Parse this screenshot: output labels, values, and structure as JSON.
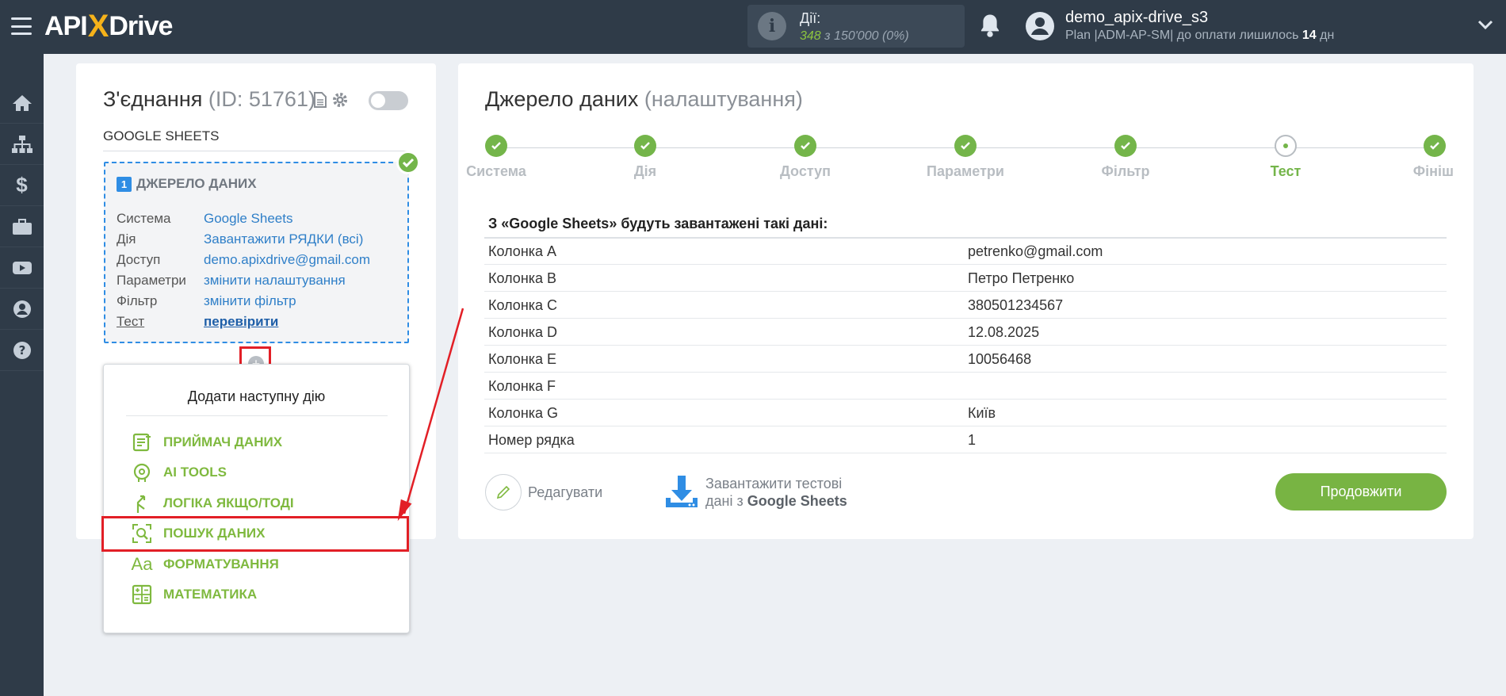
{
  "header": {
    "logo": {
      "a": "API",
      "x": "X",
      "b": "Drive"
    },
    "actions_label": "Дії:",
    "actions_used": "348",
    "actions_of": "з 150'000",
    "actions_pct": "(0%)",
    "user_name": "demo_apix-drive_s3",
    "plan_prefix": "Plan |ADM-AP-SM| до оплати лишилось",
    "plan_days": "14",
    "plan_suffix": "дн"
  },
  "sidebar": {
    "items": [
      "home-icon",
      "sitemap-icon",
      "dollar-icon",
      "briefcase-icon",
      "youtube-icon",
      "user-icon",
      "help-icon"
    ]
  },
  "connection": {
    "title": "З'єднання",
    "id_text": "(ID: 51761)",
    "name": "GOOGLE SHEETS",
    "source_number": "1",
    "source_heading": "ДЖЕРЕЛО ДАНИХ",
    "rows": [
      {
        "k": "Система",
        "v": "Google Sheets"
      },
      {
        "k": "Дія",
        "v": "Завантажити РЯДКИ (всі)"
      },
      {
        "k": "Доступ",
        "v": "demo.apixdrive@gmail.com"
      },
      {
        "k": "Параметри",
        "v": "змінити налаштування"
      },
      {
        "k": "Фільтр",
        "v": "змінити фільтр"
      },
      {
        "k": "Тест",
        "v": "перевірити"
      }
    ]
  },
  "add_action": {
    "plus": "+",
    "title": "Додати наступну дію",
    "items": [
      {
        "label": "ПРИЙМАЧ ДАНИХ",
        "icon": "receiver-icon"
      },
      {
        "label": "AI TOOLS",
        "icon": "ai-icon"
      },
      {
        "label": "ЛОГІКА ЯКЩО/ТОДІ",
        "icon": "logic-icon"
      },
      {
        "label": "ПОШУК ДАНИХ",
        "icon": "search-data-icon"
      },
      {
        "label": "ФОРМАТУВАННЯ",
        "icon": "format-icon"
      },
      {
        "label": "МАТЕМАТИКА",
        "icon": "math-icon"
      }
    ]
  },
  "source": {
    "title": "Джерело даних",
    "subtitle": "(налаштування)",
    "steps": [
      "Система",
      "Дія",
      "Доступ",
      "Параметри",
      "Фільтр",
      "Тест",
      "Фініш"
    ],
    "current_step": "Тест",
    "data_heading": "З «Google Sheets» будуть завантажені такі дані:",
    "rows": [
      {
        "k": "Колонка A",
        "v": "petrenko@gmail.com"
      },
      {
        "k": "Колонка B",
        "v": "Петро Петренко"
      },
      {
        "k": "Колонка C",
        "v": "380501234567"
      },
      {
        "k": "Колонка D",
        "v": "12.08.2025"
      },
      {
        "k": "Колонка E",
        "v": "10056468"
      },
      {
        "k": "Колонка F",
        "v": ""
      },
      {
        "k": "Колонка G",
        "v": "Київ"
      },
      {
        "k": "Номер рядка",
        "v": "1"
      }
    ],
    "edit_label": "Редагувати",
    "download_line1": "Завантажити тестові",
    "download_line2_prefix": "дані з",
    "download_line2_bold": "Google Sheets",
    "continue_label": "Продовжити"
  },
  "colors": {
    "accent_green": "#78b443",
    "header_bg": "#2f3b48",
    "link_blue": "#2f7fc8",
    "highlight_red": "#e21f26"
  }
}
